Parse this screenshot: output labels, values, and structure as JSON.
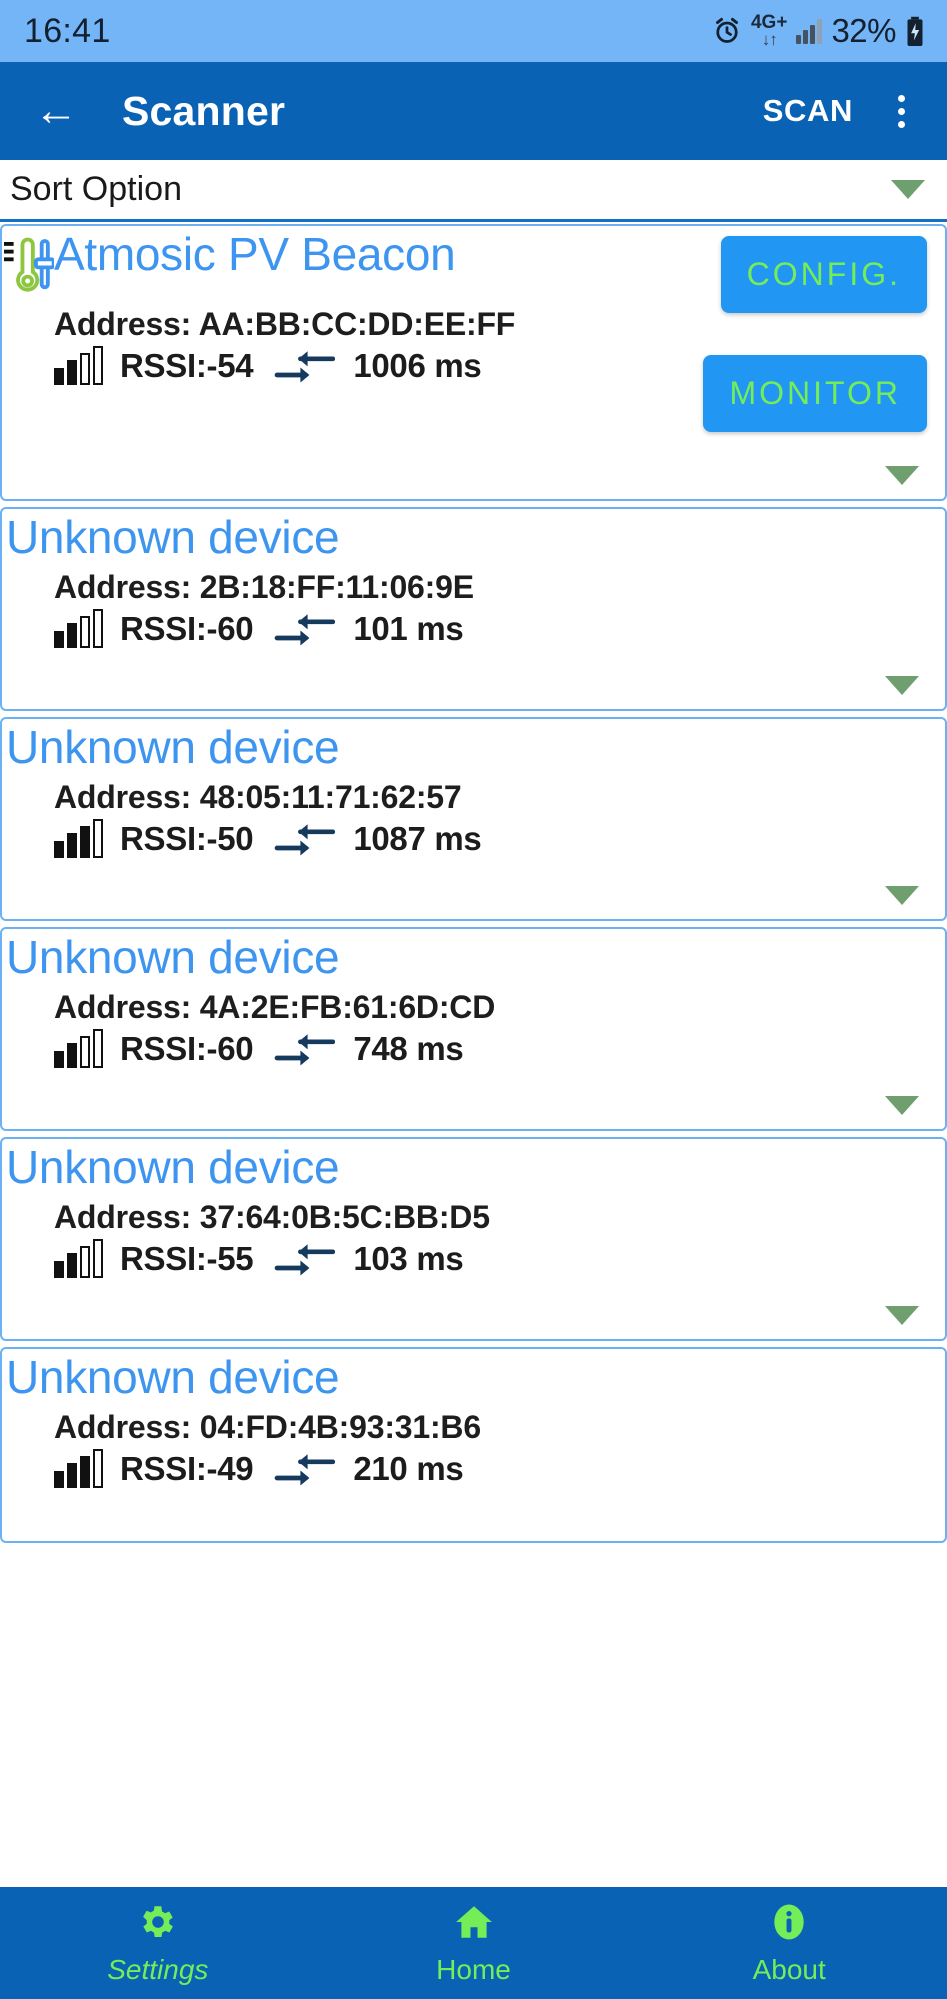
{
  "statusbar": {
    "time": "16:41",
    "alarm_icon": "alarm-icon",
    "network_label": "4G+",
    "network_arrows": "↓↑",
    "signal_icon": "signal-bars-icon",
    "battery_percent": "32%",
    "battery_icon": "battery-charging-icon"
  },
  "appbar": {
    "back_icon": "back-arrow-icon",
    "title": "Scanner",
    "scan_label": "SCAN",
    "overflow_icon": "overflow-menu-icon"
  },
  "sort": {
    "label": "Sort Option",
    "caret_icon": "chevron-down-icon"
  },
  "devices": [
    {
      "name": "Atmosic PV Beacon",
      "has_sensor_icon": true,
      "sensor_icon": "thermometer-sensor-icon",
      "address_label": "Address: AA:BB:CC:DD:EE:FF",
      "rssi_label": "RSSI:-54",
      "rssi_value": -54,
      "bars_filled": 2,
      "interval_label": "1006 ms",
      "interval_icon": "interval-arrows-icon",
      "buttons": [
        "CONFIG.",
        "MONITOR"
      ],
      "expand_icon": "chevron-down-icon"
    },
    {
      "name": "Unknown device",
      "has_sensor_icon": false,
      "address_label": "Address: 2B:18:FF:11:06:9E",
      "rssi_label": "RSSI:-60",
      "rssi_value": -60,
      "bars_filled": 2,
      "interval_label": "101 ms",
      "interval_icon": "interval-arrows-icon",
      "buttons": [],
      "expand_icon": "chevron-down-icon"
    },
    {
      "name": "Unknown device",
      "has_sensor_icon": false,
      "address_label": "Address: 48:05:11:71:62:57",
      "rssi_label": "RSSI:-50",
      "rssi_value": -50,
      "bars_filled": 3,
      "interval_label": "1087 ms",
      "interval_icon": "interval-arrows-icon",
      "buttons": [],
      "expand_icon": "chevron-down-icon"
    },
    {
      "name": "Unknown device",
      "has_sensor_icon": false,
      "address_label": "Address: 4A:2E:FB:61:6D:CD",
      "rssi_label": "RSSI:-60",
      "rssi_value": -60,
      "bars_filled": 2,
      "interval_label": "748 ms",
      "interval_icon": "interval-arrows-icon",
      "buttons": [],
      "expand_icon": "chevron-down-icon"
    },
    {
      "name": "Unknown device",
      "has_sensor_icon": false,
      "address_label": "Address: 37:64:0B:5C:BB:D5",
      "rssi_label": "RSSI:-55",
      "rssi_value": -55,
      "bars_filled": 2,
      "interval_label": "103 ms",
      "interval_icon": "interval-arrows-icon",
      "buttons": [],
      "expand_icon": "chevron-down-icon"
    },
    {
      "name": "Unknown device",
      "has_sensor_icon": false,
      "address_label": "Address: 04:FD:4B:93:31:B6",
      "rssi_label": "RSSI:-49",
      "rssi_value": -49,
      "bars_filled": 3,
      "interval_label": "210 ms",
      "interval_icon": "interval-arrows-icon",
      "buttons": [],
      "expand_icon": "chevron-down-icon"
    }
  ],
  "bottomnav": [
    {
      "label": "Settings",
      "icon": "gear-icon"
    },
    {
      "label": "Home",
      "icon": "home-icon"
    },
    {
      "label": "About",
      "icon": "info-icon"
    }
  ],
  "colors": {
    "status_bar_bg": "#74b5f7",
    "app_bar_bg": "#0a62b4",
    "card_border": "#6cb2f2",
    "device_name": "#3d95ef",
    "button_bg": "#2196f3",
    "button_text": "#74ed58",
    "caret_green": "#6f9e6f",
    "nav_accent": "#74ed58"
  }
}
